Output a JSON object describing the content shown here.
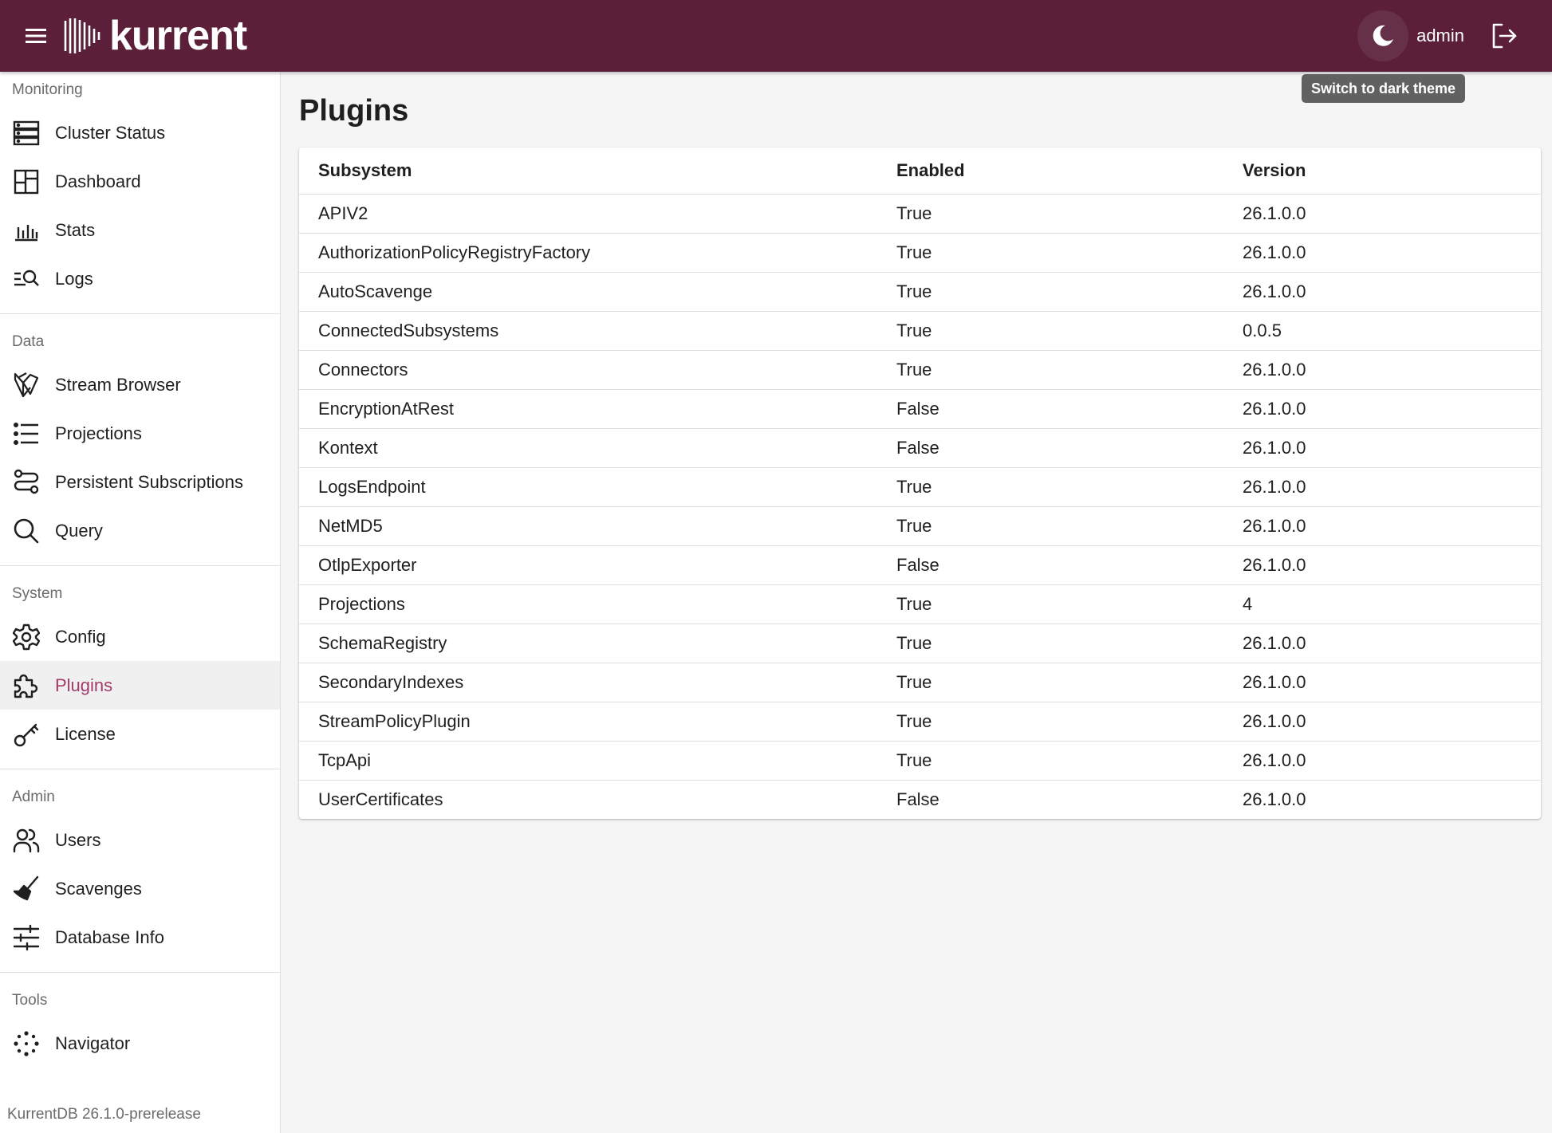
{
  "app": {
    "brand": "kurrent",
    "user": "admin",
    "tooltip": "Switch to dark theme",
    "version": "KurrentDB 26.1.0-prerelease",
    "colors": {
      "topbar": "#5b1f3a",
      "accent": "#a33a6a"
    }
  },
  "sidebar": {
    "sections": [
      {
        "title": "Monitoring",
        "items": [
          {
            "label": "Cluster Status",
            "icon": "server-icon"
          },
          {
            "label": "Dashboard",
            "icon": "dashboard-icon"
          },
          {
            "label": "Stats",
            "icon": "bar-chart-icon"
          },
          {
            "label": "Logs",
            "icon": "log-search-icon"
          }
        ]
      },
      {
        "title": "Data",
        "items": [
          {
            "label": "Stream Browser",
            "icon": "stream-icon"
          },
          {
            "label": "Projections",
            "icon": "list-icon"
          },
          {
            "label": "Persistent Subscriptions",
            "icon": "route-icon"
          },
          {
            "label": "Query",
            "icon": "search-icon"
          }
        ]
      },
      {
        "title": "System",
        "items": [
          {
            "label": "Config",
            "icon": "gear-icon"
          },
          {
            "label": "Plugins",
            "icon": "puzzle-icon",
            "active": true
          },
          {
            "label": "License",
            "icon": "key-icon"
          }
        ]
      },
      {
        "title": "Admin",
        "items": [
          {
            "label": "Users",
            "icon": "users-icon"
          },
          {
            "label": "Scavenges",
            "icon": "broom-icon"
          },
          {
            "label": "Database Info",
            "icon": "sliders-icon"
          }
        ]
      },
      {
        "title": "Tools",
        "items": [
          {
            "label": "Navigator",
            "icon": "navigator-icon"
          }
        ]
      }
    ]
  },
  "page": {
    "title": "Plugins",
    "table": {
      "headers": [
        "Subsystem",
        "Enabled",
        "Version"
      ],
      "rows": [
        [
          "APIV2",
          "True",
          "26.1.0.0"
        ],
        [
          "AuthorizationPolicyRegistryFactory",
          "True",
          "26.1.0.0"
        ],
        [
          "AutoScavenge",
          "True",
          "26.1.0.0"
        ],
        [
          "ConnectedSubsystems",
          "True",
          "0.0.5"
        ],
        [
          "Connectors",
          "True",
          "26.1.0.0"
        ],
        [
          "EncryptionAtRest",
          "False",
          "26.1.0.0"
        ],
        [
          "Kontext",
          "False",
          "26.1.0.0"
        ],
        [
          "LogsEndpoint",
          "True",
          "26.1.0.0"
        ],
        [
          "NetMD5",
          "True",
          "26.1.0.0"
        ],
        [
          "OtlpExporter",
          "False",
          "26.1.0.0"
        ],
        [
          "Projections",
          "True",
          "4"
        ],
        [
          "SchemaRegistry",
          "True",
          "26.1.0.0"
        ],
        [
          "SecondaryIndexes",
          "True",
          "26.1.0.0"
        ],
        [
          "StreamPolicyPlugin",
          "True",
          "26.1.0.0"
        ],
        [
          "TcpApi",
          "True",
          "26.1.0.0"
        ],
        [
          "UserCertificates",
          "False",
          "26.1.0.0"
        ]
      ]
    }
  }
}
